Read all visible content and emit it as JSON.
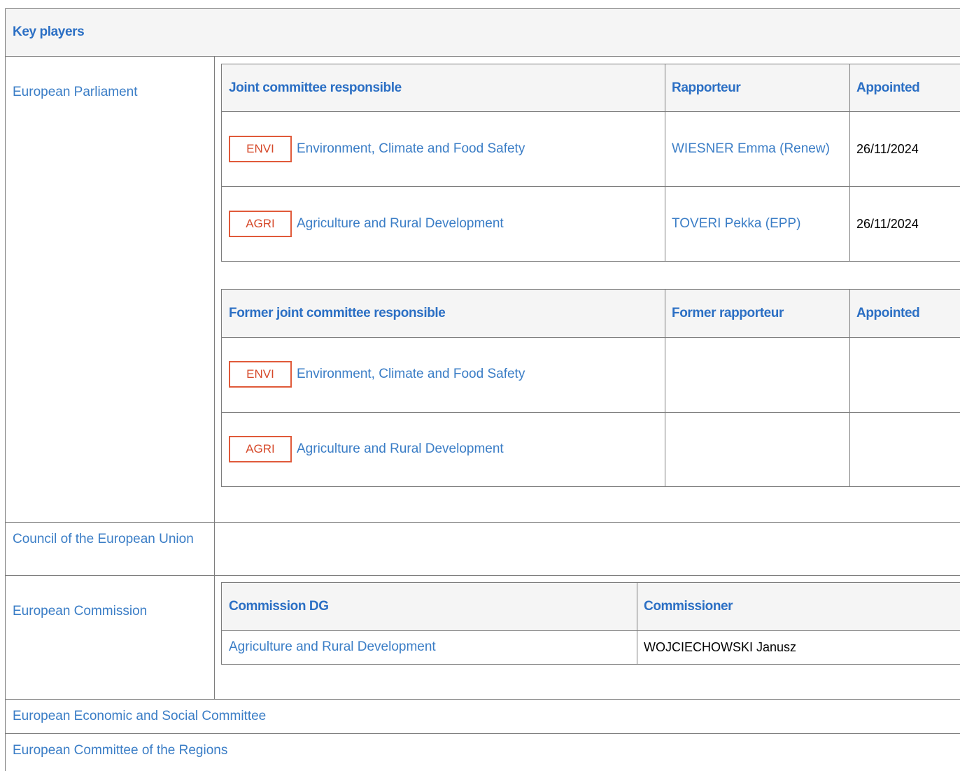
{
  "header": {
    "title": "Key players"
  },
  "rows": {
    "parliament": {
      "label": "European Parliament"
    },
    "council": {
      "label": "Council of the European Union"
    },
    "commission": {
      "label": "European Commission"
    },
    "eesc": {
      "label": "European Economic and Social Committee"
    },
    "cor": {
      "label": "European Committee of the Regions"
    }
  },
  "joint_committee": {
    "headers": {
      "committee": "Joint committee responsible",
      "rapporteur": "Rapporteur",
      "appointed": "Appointed"
    },
    "rows": [
      {
        "code": "ENVI",
        "name": "Environment, Climate and Food Safety",
        "rapporteur": "WIESNER Emma (Renew)",
        "appointed": "26/11/2024"
      },
      {
        "code": "AGRI",
        "name": "Agriculture and Rural Development",
        "rapporteur": "TOVERI Pekka (EPP)",
        "appointed": "26/11/2024"
      }
    ]
  },
  "former_joint_committee": {
    "headers": {
      "committee": "Former joint committee responsible",
      "rapporteur": "Former rapporteur",
      "appointed": "Appointed"
    },
    "rows": [
      {
        "code": "ENVI",
        "name": "Environment, Climate and Food Safety",
        "rapporteur": "",
        "appointed": ""
      },
      {
        "code": "AGRI",
        "name": "Agriculture and Rural Development",
        "rapporteur": "",
        "appointed": ""
      }
    ]
  },
  "commission_table": {
    "headers": {
      "dg": "Commission DG",
      "commissioner": "Commissioner"
    },
    "rows": [
      {
        "dg": "Agriculture and Rural Development",
        "commissioner": "WOJCIECHOWSKI Janusz"
      }
    ]
  },
  "colors": {
    "link": "#3a7dc6",
    "header_text": "#2b6fc4",
    "badge_border": "#e05a3a",
    "header_bg": "#f5f5f5",
    "border": "#7d7d7d"
  }
}
